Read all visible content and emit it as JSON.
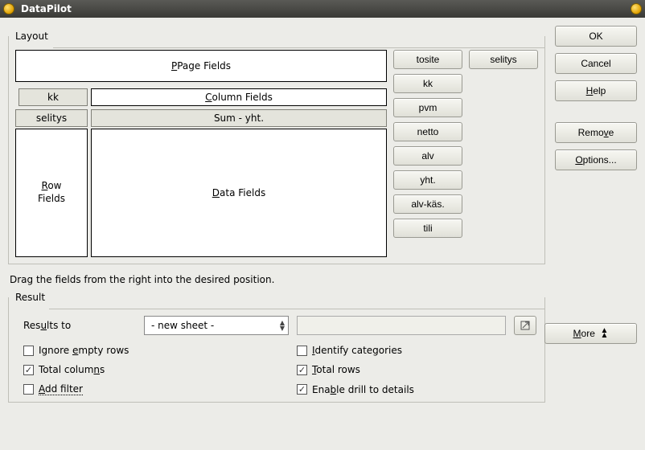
{
  "window": {
    "title": "DataPilot"
  },
  "groups": {
    "layout": "Layout",
    "result": "Result"
  },
  "drops": {
    "page": "Page Fields",
    "column": "Column Fields",
    "row_l1": "Row",
    "row_l2": "Fields",
    "data": "Data Fields"
  },
  "assigned": {
    "col_field": "kk",
    "row_field": "selitys",
    "data_field": "Sum - yht."
  },
  "available1": [
    "tosite",
    "kk",
    "pvm",
    "netto",
    "alv",
    "yht.",
    "alv-käs.",
    "tili"
  ],
  "available2": [
    "selitys"
  ],
  "actions": {
    "ok": "OK",
    "cancel": "Cancel",
    "help": "Help",
    "remove": "Remove",
    "options": "Options...",
    "more": "More"
  },
  "instruction": "Drag the fields from the right into the desired position.",
  "results": {
    "label": "Results to",
    "combo": "- new sheet -"
  },
  "checks": {
    "ignore": "Ignore empty rows",
    "identify": "Identify categories",
    "totalcols": "Total columns",
    "totalrows": "Total rows",
    "addfilter": "Add filter",
    "drill": "Enable drill to details"
  }
}
